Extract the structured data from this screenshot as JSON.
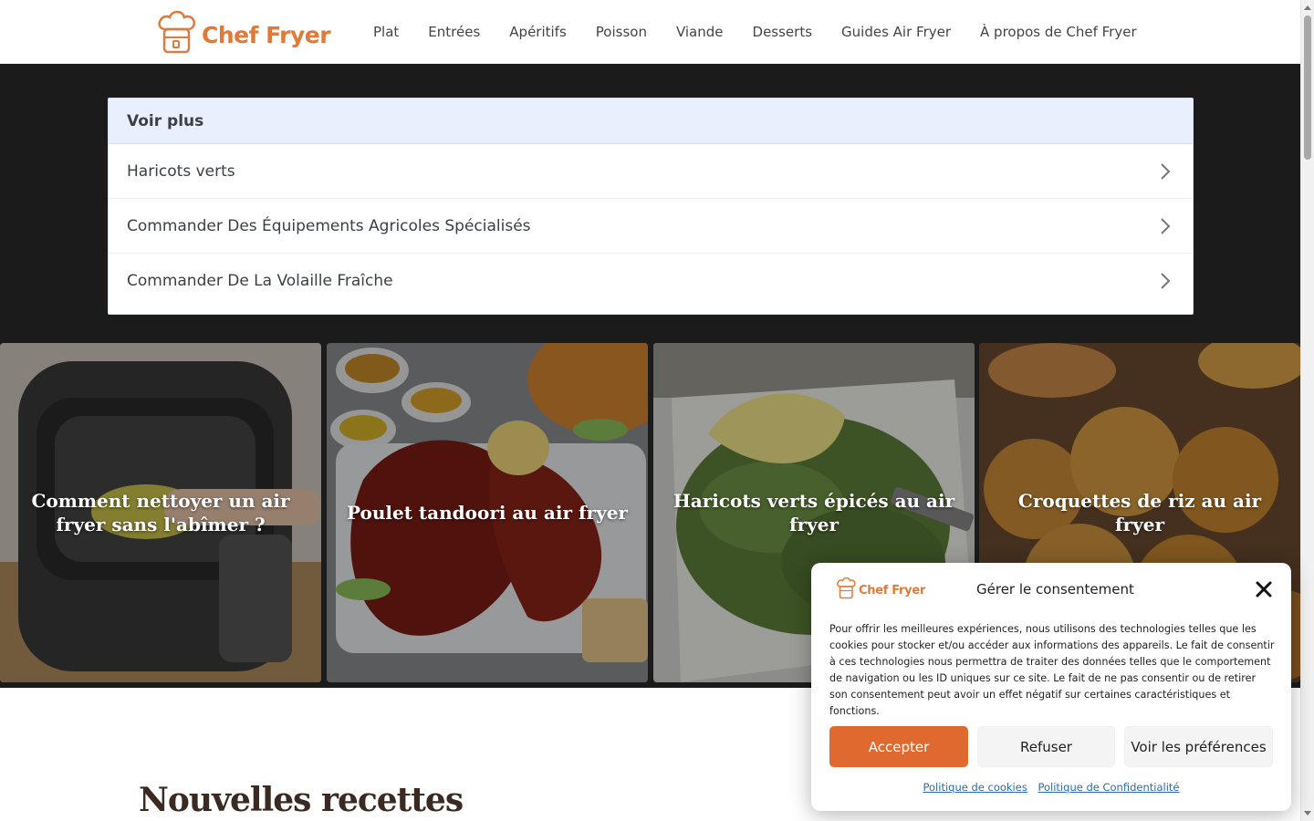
{
  "header": {
    "logo_text": "Chef Fryer",
    "nav": [
      "Plat",
      "Entrées",
      "Apéritifs",
      "Poisson",
      "Viande",
      "Desserts",
      "Guides Air Fryer",
      "À propos de Chef Fryer"
    ]
  },
  "suggestions": {
    "title": "Voir plus",
    "items": [
      "Haricots verts",
      "Commander Des Équipements Agricoles Spécialisés",
      "Commander De La Volaille Fraîche"
    ]
  },
  "cards": [
    {
      "title": "Comment nettoyer un air fryer sans l'abîmer ?"
    },
    {
      "title": "Poulet tandoori au air fryer"
    },
    {
      "title": "Haricots verts épicés au air fryer"
    },
    {
      "title": "Croquettes de riz au air fryer"
    }
  ],
  "section": {
    "title": "Nouvelles recettes"
  },
  "consent": {
    "logo_text": "Chef Fryer",
    "title": "Gérer le consentement",
    "text": "Pour offrir les meilleures expériences, nous utilisons des technologies telles que les cookies pour stocker et/ou accéder aux informations des appareils. Le fait de consentir à ces technologies nous permettra de traiter des données telles que le comportement de navigation ou les ID uniques sur ce site. Le fait de ne pas consentir ou de retirer son consentement peut avoir un effet négatif sur certaines caractéristiques et fonctions.",
    "accept_label": "Accepter",
    "refuse_label": "Refuser",
    "prefs_label": "Voir les préférences",
    "cookie_policy_label": "Politique de cookies",
    "privacy_policy_label": "Politique de Confidentialité"
  },
  "colors": {
    "brand": "#e07a3a",
    "accept_button": "#e0692f",
    "dark_band": "#1b1b1b",
    "suggest_header": "#e8f0fe"
  },
  "icons": {
    "logo": "chef-hat-icon",
    "row_arrow": "chevron-right-icon",
    "close": "close-icon"
  }
}
